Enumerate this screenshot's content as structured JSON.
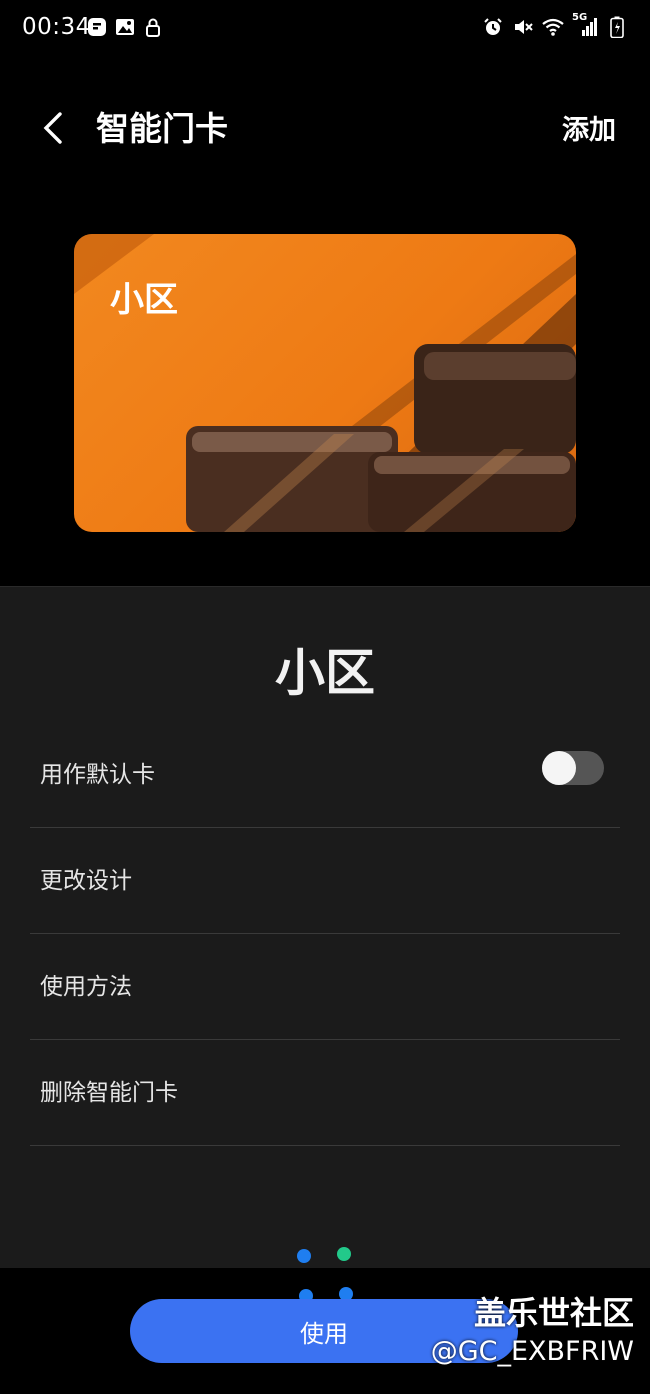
{
  "status_bar": {
    "time": "00:34",
    "left_icons": [
      "notification-icon",
      "gallery-icon",
      "lock-icon"
    ],
    "right_icons": [
      "alarm-icon",
      "mute-icon",
      "wifi-icon",
      "signal-icon",
      "battery-icon"
    ],
    "network_label": "5G"
  },
  "header": {
    "title": "智能门卡",
    "action_label": "添加"
  },
  "card": {
    "name": "小区"
  },
  "detail": {
    "title": "小区",
    "items": [
      {
        "label": "用作默认卡",
        "toggle": false
      },
      {
        "label": "更改设计"
      },
      {
        "label": "使用方法"
      },
      {
        "label": "删除智能门卡"
      }
    ]
  },
  "use_button_label": "使用",
  "watermark": {
    "title": "盖乐世社区",
    "id": "@GC_EXBFRIW"
  },
  "colors": {
    "accent": "#3b72f2",
    "card_orange": "#f2881f",
    "dot_blue": "#1f7ef0",
    "dot_green": "#22c98a"
  }
}
